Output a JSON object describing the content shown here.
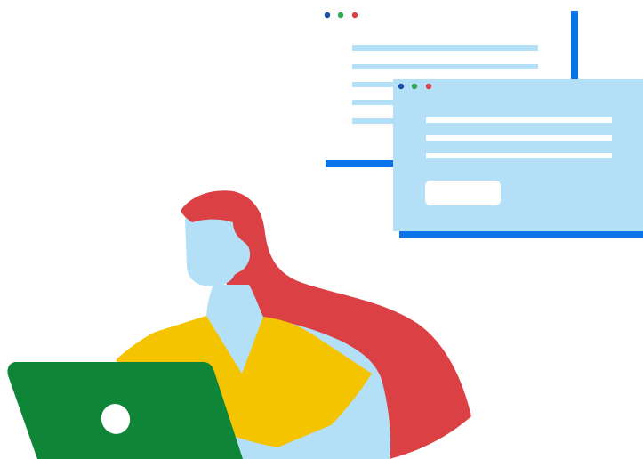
{
  "illustration": {
    "subject": "person-with-laptop-and-browser-windows",
    "icons": {
      "back_window": "browser-window-icon",
      "front_window": "browser-window-icon",
      "window_dots": [
        "close-dot",
        "minimize-dot",
        "maximize-dot"
      ],
      "laptop": "laptop-icon",
      "person": "person-figure"
    },
    "colors": {
      "background": "#ffffff",
      "window_blue_light": "#b3e0f7",
      "window_line_blue": "#b3e0f7",
      "accent_blue": "#0a73e8",
      "dot_blue": "#174ea6",
      "dot_green": "#34a853",
      "dot_red": "#db4144",
      "hair_red": "#db4144",
      "shirt_yellow": "#f4c400",
      "skin_light_blue": "#b3e0f7",
      "laptop_green": "#0f8537",
      "button_white": "#ffffff"
    }
  }
}
